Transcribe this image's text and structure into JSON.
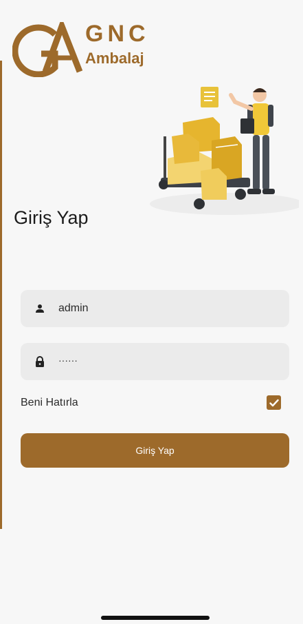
{
  "brand": {
    "name": "GNC",
    "subtitle": "Ambalaj",
    "color": "#9d6a2b"
  },
  "login": {
    "title": "Giriş Yap",
    "username_value": "admin",
    "password_value": "······",
    "remember_label": "Beni Hatırla",
    "remember_checked": true,
    "submit_label": "Giriş Yap"
  },
  "icons": {
    "user": "person-icon",
    "password": "lock-icon",
    "check": "check-icon"
  },
  "colors": {
    "accent": "#9d6a2b",
    "field_bg": "#ebebeb",
    "page_bg": "#f7f7f7"
  }
}
